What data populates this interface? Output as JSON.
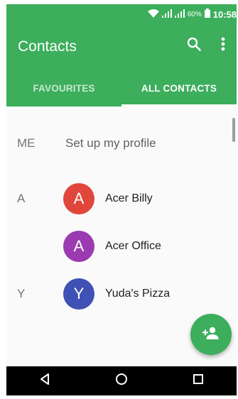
{
  "status_bar": {
    "battery": "60%",
    "time": "10:58",
    "icons": [
      "wifi-icon",
      "signal-icon",
      "signal-icon",
      "battery-icon"
    ]
  },
  "app_bar": {
    "title": "Contacts",
    "actions": [
      "search-icon",
      "more-vert-icon"
    ]
  },
  "tabs": [
    {
      "label": "FAVOURITES",
      "selected": false
    },
    {
      "label": "ALL CONTACTS",
      "selected": true
    }
  ],
  "profile": {
    "section": "ME",
    "label": "Set up my profile"
  },
  "contacts": [
    {
      "section": "A",
      "initial": "A",
      "name": "Acer Billy",
      "color": "#e0463c"
    },
    {
      "section": "",
      "initial": "A",
      "name": "Acer Office",
      "color": "#9b3ab1"
    },
    {
      "section": "Y",
      "initial": "Y",
      "name": "Yuda's Pizza",
      "color": "#3f51b5"
    }
  ],
  "fab": {
    "icon": "add-person-icon"
  },
  "nav": [
    "back-icon",
    "home-icon",
    "recents-icon"
  ],
  "colors": {
    "primary": "#3cae5c",
    "nav_bg": "#000000"
  }
}
